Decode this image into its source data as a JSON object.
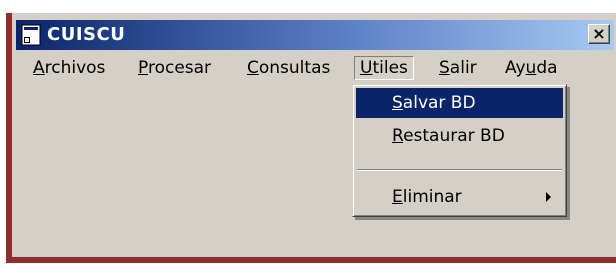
{
  "window": {
    "title": "CUISCU",
    "close_label": "×",
    "colors": {
      "titlebar_start": "#0a246a",
      "titlebar_end": "#a6caf0",
      "face": "#d4d0c8",
      "highlight": "#0a246a",
      "frame": "#8e2e2e"
    }
  },
  "menu_bar": {
    "items": [
      {
        "pre": "",
        "mnemonic": "A",
        "post": "rchivos"
      },
      {
        "pre": "",
        "mnemonic": "P",
        "post": "rocesar"
      },
      {
        "pre": "",
        "mnemonic": "C",
        "post": "onsultas"
      },
      {
        "pre": "",
        "mnemonic": "U",
        "post": "tiles"
      },
      {
        "pre": "",
        "mnemonic": "S",
        "post": "alir"
      },
      {
        "pre": "Ay",
        "mnemonic": "u",
        "post": "da"
      }
    ],
    "open_menu": "Utiles"
  },
  "dropdown": {
    "items": [
      {
        "pre": "",
        "mnemonic": "S",
        "post": "alvar BD",
        "selected": true
      },
      {
        "pre": "",
        "mnemonic": "R",
        "post": "estaurar BD",
        "selected": false
      },
      {
        "pre": "",
        "mnemonic": "E",
        "post": "liminar",
        "selected": false,
        "has_submenu": true
      }
    ]
  },
  "icons": {
    "app": "application-icon",
    "close": "close-icon",
    "submenu": "submenu-arrow-icon"
  }
}
